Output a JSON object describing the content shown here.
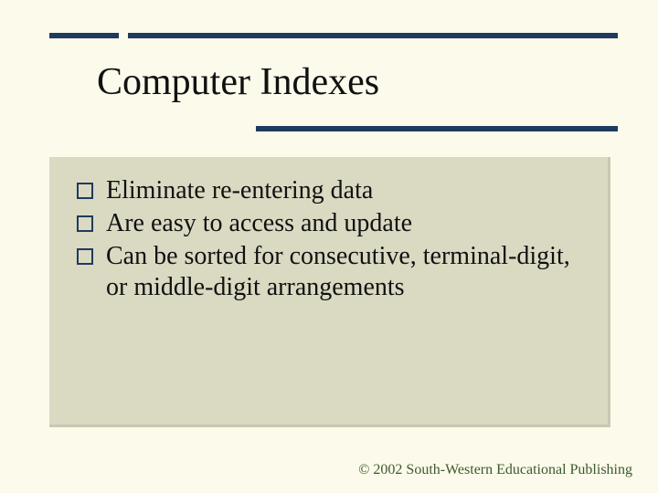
{
  "title": "Computer Indexes",
  "bullets": [
    {
      "text": "Eliminate re-entering data"
    },
    {
      "text": "Are easy to access and update"
    },
    {
      "text": "Can be sorted for consecutive, terminal-digit, or middle-digit arrangements"
    }
  ],
  "footer": "© 2002 South-Western Educational Publishing"
}
